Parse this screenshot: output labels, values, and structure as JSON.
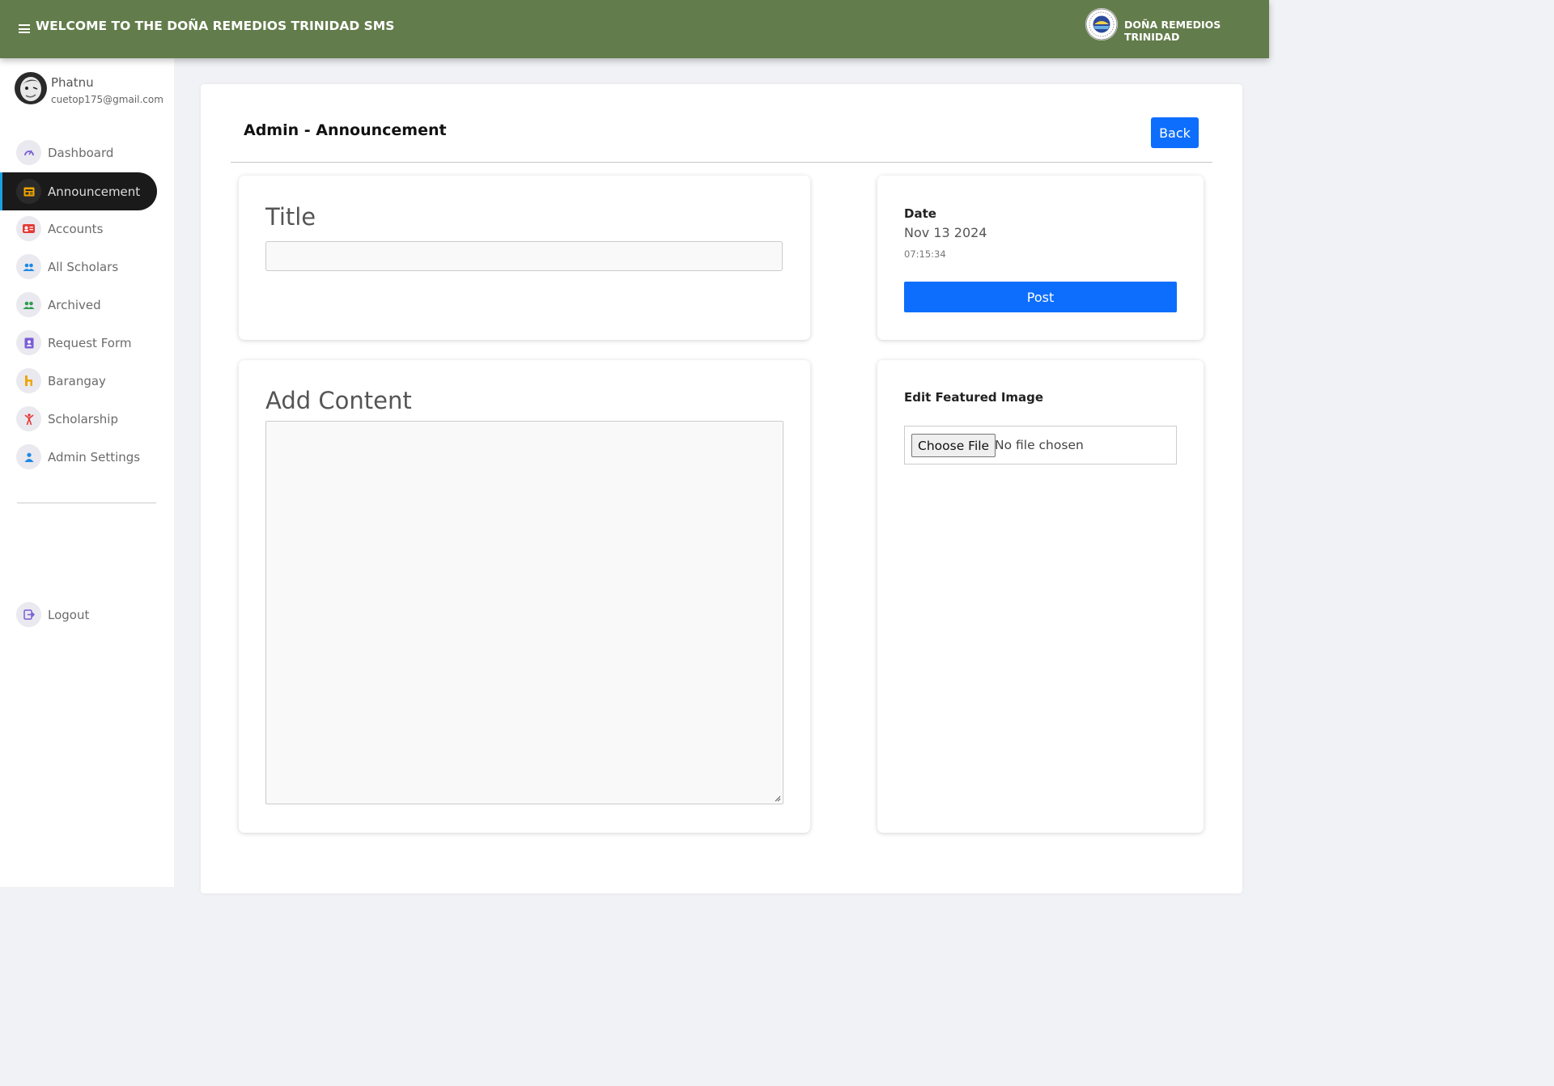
{
  "header": {
    "title": "WELCOME TO THE DOÑA REMEDIOS TRINIDAD SMS",
    "brand": "DOÑA REMEDIOS TRINIDAD",
    "color": "#637c4b"
  },
  "user": {
    "name": "Phatnu",
    "email": "cuetop175@gmail.com"
  },
  "sidebar": {
    "active_index": 1,
    "items": [
      {
        "label": "Dashboard",
        "icon": "speedometer-icon",
        "color": "#7b5cd6"
      },
      {
        "label": "Announcement",
        "icon": "newspaper-icon",
        "color": "#f0a500"
      },
      {
        "label": "Accounts",
        "icon": "id-card-icon",
        "color": "#e53935"
      },
      {
        "label": "All Scholars",
        "icon": "people-icon",
        "color": "#1e88e5"
      },
      {
        "label": "Archived",
        "icon": "people-icon",
        "color": "#2e9e50"
      },
      {
        "label": "Request Form",
        "icon": "contact-book-icon",
        "color": "#7b5cd6"
      },
      {
        "label": "Barangay",
        "icon": "house-icon",
        "color": "#f0a500"
      },
      {
        "label": "Scholarship",
        "icon": "person-icon",
        "color": "#e53935"
      },
      {
        "label": "Admin Settings",
        "icon": "user-icon",
        "color": "#1e88e5"
      }
    ],
    "logout": {
      "label": "Logout",
      "icon": "logout-icon",
      "color": "#7b5cd6"
    }
  },
  "page": {
    "title": "Admin - Announcement",
    "back_label": "Back"
  },
  "form": {
    "title_label": "Title",
    "title_value": "",
    "content_label": "Add Content",
    "content_value": ""
  },
  "publish": {
    "date_label": "Date",
    "date_value": "Nov 13 2024",
    "time_value": "07:15:34",
    "post_label": "Post"
  },
  "featured_image": {
    "label": "Edit Featured Image",
    "choose_label": "Choose File",
    "status": "No file chosen"
  },
  "accent_color": "#0d6efd"
}
